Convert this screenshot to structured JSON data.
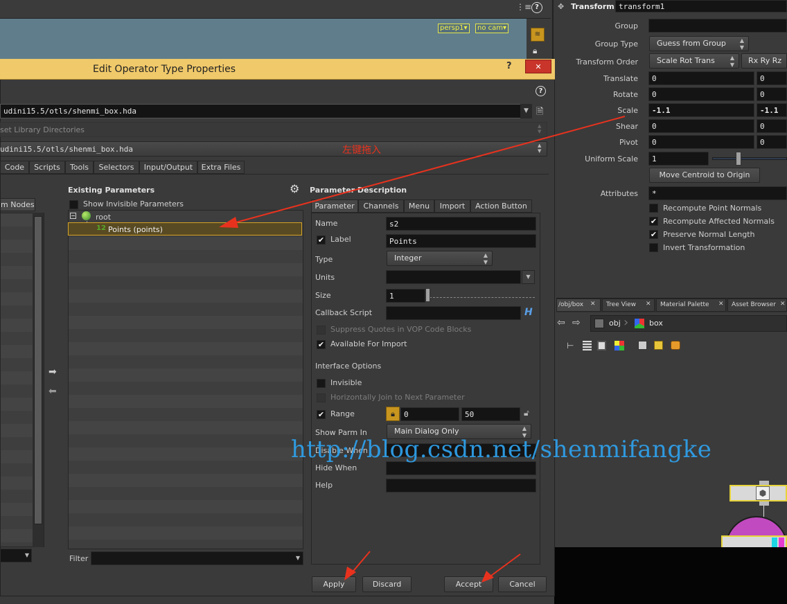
{
  "viewport": {
    "persp_label": "persp1▾",
    "cam_label": "no cam▾"
  },
  "top_bar": {
    "help_glyph": "?"
  },
  "dialog": {
    "title": "Edit Operator Type Properties",
    "help_glyph": "?",
    "close_glyph": "✕",
    "library_path": "udini15.5/otls/shenmi_box.hda",
    "asset_dirs_label": "set Library Directories",
    "save_path": "udini15.5/otls/shenmi_box.hda",
    "drag_annotation": "左键拖入",
    "tabs": [
      "Code",
      "Scripts",
      "Tools",
      "Selectors",
      "Input/Output",
      "Extra Files"
    ],
    "left_tab": "m Nodes",
    "existing": {
      "header": "Existing Parameters",
      "show_invisible": "Show Invisible Parameters",
      "root_label": "root",
      "item_label": "Points (points)",
      "filter_label": "Filter"
    },
    "desc": {
      "header": "Parameter Description",
      "tabs": [
        "Parameter",
        "Channels",
        "Menu",
        "Import",
        "Action Button"
      ],
      "name_label": "Name",
      "name_value": "s2",
      "label_label": "Label",
      "label_value": "Points",
      "type_label": "Type",
      "type_value": "Integer",
      "units_label": "Units",
      "units_value": "",
      "size_label": "Size",
      "size_value": "1",
      "callback_label": "Callback Script",
      "callback_value": "",
      "suppress_label": "Suppress Quotes in VOP Code Blocks",
      "available_label": "Available For Import",
      "interface_label": "Interface Options",
      "invisible_label": "Invisible",
      "hjoin_label": "Horizontally Join to Next Parameter",
      "range_label": "Range",
      "range_min": "0",
      "range_max": "50",
      "showparm_label": "Show Parm In",
      "showparm_value": "Main Dialog Only",
      "disable_label": "Disable When",
      "hide_label": "Hide When",
      "help_label": "Help"
    },
    "buttons": {
      "apply": "Apply",
      "discard": "Discard",
      "accept": "Accept",
      "cancel": "Cancel"
    }
  },
  "watermark": "http://blog.csdn.net/shenmifangke",
  "transform_panel": {
    "title": "Transform",
    "node_name": "transform1",
    "group_label": "Group",
    "group_value": "",
    "group_type_label": "Group Type",
    "group_type_value": "Guess from Group",
    "order_label": "Transform Order",
    "order_value": "Scale Rot Trans",
    "rot_order_value": "Rx Ry Rz",
    "translate_label": "Translate",
    "translate": [
      "0",
      "0"
    ],
    "rotate_label": "Rotate",
    "rotate": [
      "0",
      "0"
    ],
    "scale_label": "Scale",
    "scale": [
      "-1.1",
      "-1.1"
    ],
    "shear_label": "Shear",
    "shear": [
      "0",
      "0"
    ],
    "pivot_label": "Pivot",
    "pivot": [
      "0",
      "0"
    ],
    "uniform_label": "Uniform Scale",
    "uniform_value": "1",
    "centroid_button": "Move Centroid to Origin",
    "attributes_label": "Attributes",
    "attributes_value": "*",
    "recompute_normals": "Recompute Point Normals",
    "recompute_affected": "Recompute Affected Normals",
    "preserve_length": "Preserve Normal Length",
    "invert": "Invert Transformation"
  },
  "network_panel": {
    "tabs": [
      "/obj/box",
      "Tree View",
      "Material Palette",
      "Asset Browser"
    ],
    "crumb_obj": "obj",
    "crumb_box": "box"
  },
  "colors": {
    "accent_red": "#e8321e",
    "highlight_yellow": "#c9a227",
    "watermark_blue": "#2f9fe8"
  }
}
